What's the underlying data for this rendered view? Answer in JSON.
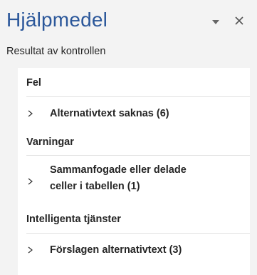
{
  "pane": {
    "title": "Hjälpmedel",
    "subtitle": "Resultat av kontrollen",
    "icons": {
      "dropdown": "caret-down-icon",
      "close": "close-icon",
      "expand": "chevron-right-icon"
    }
  },
  "sections": [
    {
      "header": "Fel",
      "items": [
        {
          "label": "Alternativtext saknas (6)"
        }
      ]
    },
    {
      "header": "Varningar",
      "items": [
        {
          "label_line1": "Sammanfogade eller delade",
          "label_line2": "celler i tabellen (1)"
        }
      ]
    },
    {
      "header": "Intelligenta tjänster",
      "items": [
        {
          "label": "Förslagen alternativtext (3)"
        }
      ]
    }
  ],
  "colors": {
    "title": "#2b579a",
    "panel_bg": "#f3f3f3",
    "results_bg": "#ffffff"
  }
}
